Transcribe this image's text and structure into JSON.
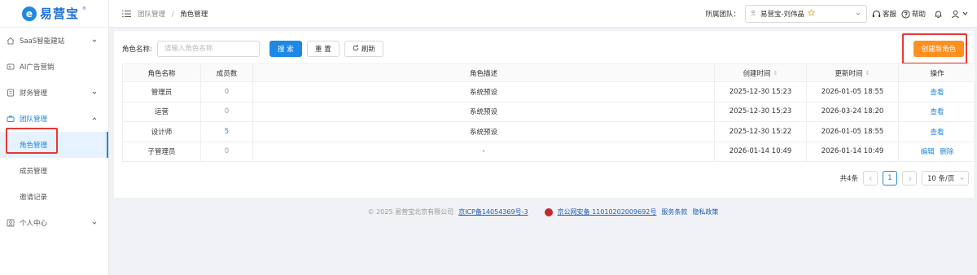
{
  "brand": {
    "name": "易营宝",
    "mark": "e",
    "reg": "®"
  },
  "sidebar": {
    "items": [
      {
        "label": "SaaS智能建站",
        "icon": "home-icon",
        "has_chevron": true,
        "chevron": "down"
      },
      {
        "label": "AI广告营销",
        "icon": "ad-icon",
        "has_chevron": false
      },
      {
        "label": "财务管理",
        "icon": "finance-icon",
        "has_chevron": true,
        "chevron": "down"
      },
      {
        "label": "团队管理",
        "icon": "team-icon",
        "has_chevron": true,
        "chevron": "up",
        "open": true,
        "children": [
          {
            "label": "角色管理",
            "active": true
          },
          {
            "label": "成员管理",
            "active": false
          },
          {
            "label": "邀请记录",
            "active": false
          }
        ]
      },
      {
        "label": "个人中心",
        "icon": "user-icon",
        "has_chevron": true,
        "chevron": "down"
      }
    ]
  },
  "header": {
    "breadcrumb": [
      "团队管理",
      "角色管理"
    ],
    "team_label": "所属团队：",
    "team_value": "易营宝-刘伟晶",
    "service_label": "客服",
    "help_label": "帮助"
  },
  "toolbar": {
    "role_name_label": "角色名称:",
    "role_name_placeholder": "请输入角色名称",
    "search_label": "搜 索",
    "reset_label": "重 置",
    "refresh_label": "刷新",
    "create_label": "创建新角色"
  },
  "table": {
    "columns": [
      "角色名称",
      "成员数",
      "角色描述",
      "创建时间",
      "更新时间",
      "操作"
    ],
    "sortable": [
      false,
      false,
      false,
      true,
      true,
      false
    ],
    "rows": [
      {
        "name": "管理员",
        "members": "0",
        "desc": "系统预设",
        "created": "2025-12-30 15:23",
        "updated": "2026-01-05 18:55",
        "actions": [
          "查看"
        ]
      },
      {
        "name": "运营",
        "members": "0",
        "desc": "系统预设",
        "created": "2025-12-30 15:23",
        "updated": "2026-03-24 18:20",
        "actions": [
          "查看"
        ]
      },
      {
        "name": "设计师",
        "members": "5",
        "desc": "系统预设",
        "created": "2025-12-30 15:22",
        "updated": "2026-01-05 18:55",
        "actions": [
          "查看"
        ]
      },
      {
        "name": "子管理员",
        "members": "0",
        "desc": "-",
        "created": "2026-01-14 10:49",
        "updated": "2026-01-14 10:49",
        "actions": [
          "编辑",
          "删除"
        ]
      }
    ]
  },
  "pagination": {
    "total_label": "共4条",
    "current_page": "1",
    "page_size_label": "10 条/页"
  },
  "footer": {
    "copyright": "© 2025 易营宝北京有限公司",
    "icp": "京ICP备14054369号-3",
    "police": "京公网安备 11010202009692号",
    "terms": "服务条款",
    "privacy": "隐私政策"
  },
  "colors": {
    "primary": "#1e88e5",
    "accent": "#ff8f1f",
    "highlight": "#e53935"
  }
}
